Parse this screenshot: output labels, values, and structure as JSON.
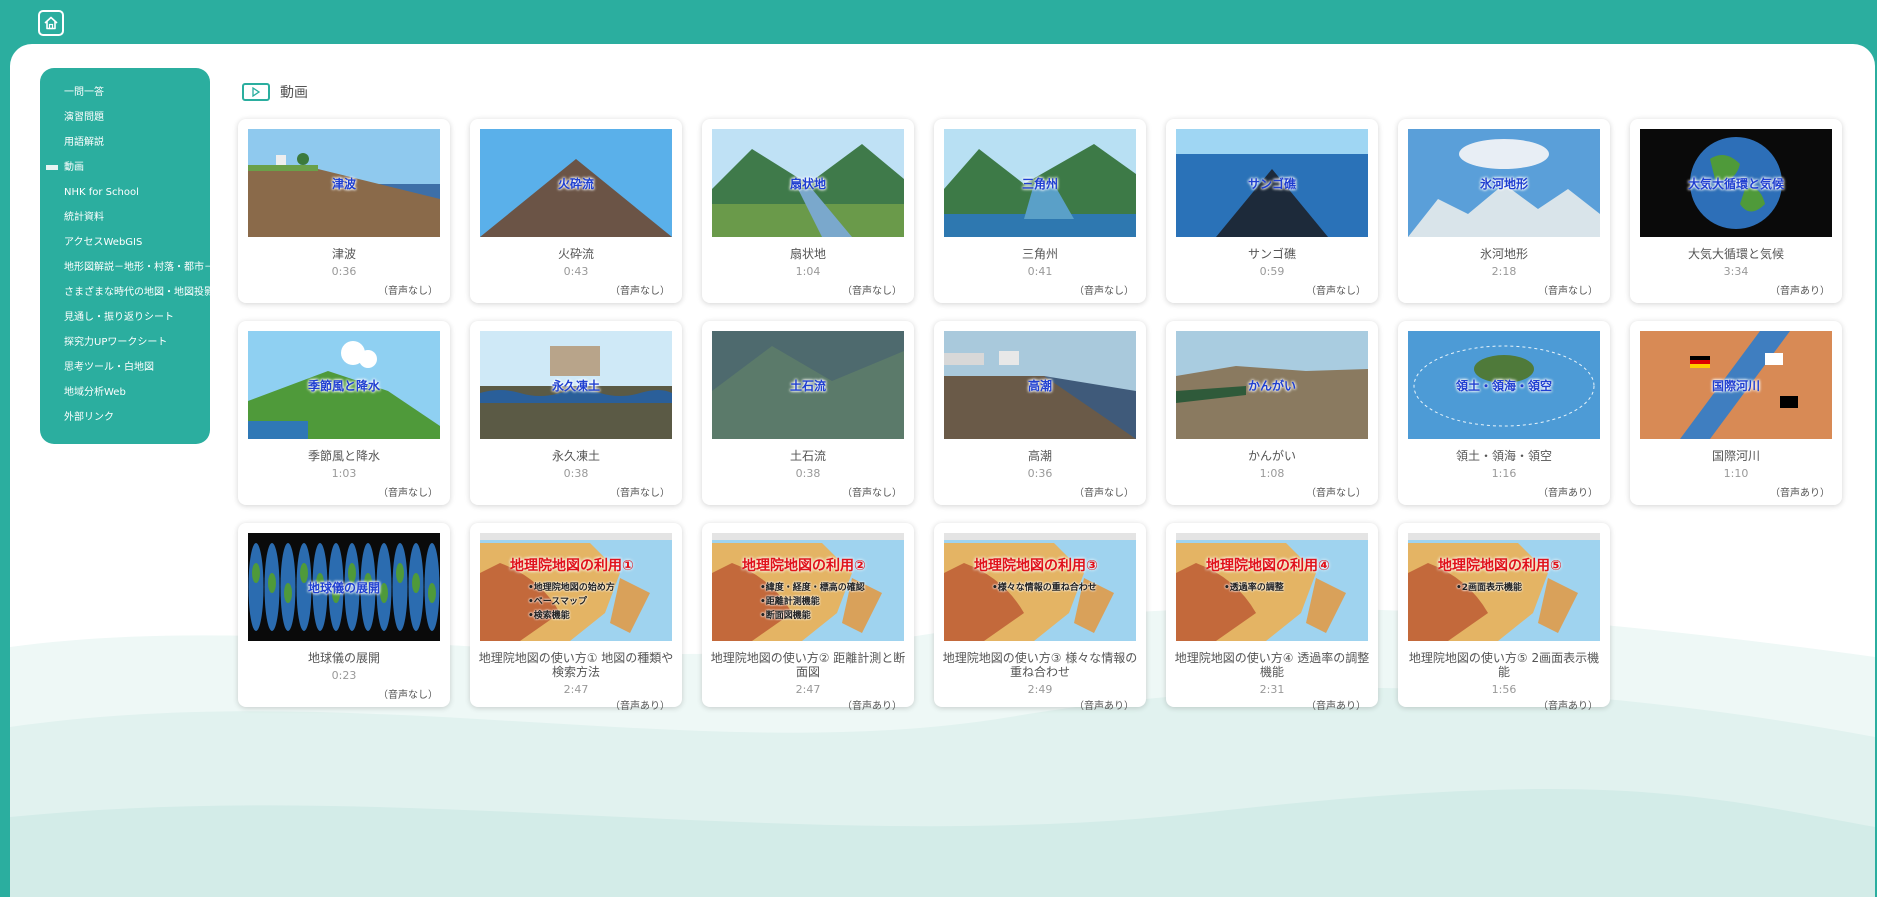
{
  "header": {
    "home_icon": "home-icon"
  },
  "sidebar": {
    "items": [
      {
        "label": "一問一答",
        "active": false
      },
      {
        "label": "演習問題",
        "active": false
      },
      {
        "label": "用語解説",
        "active": false
      },
      {
        "label": "動画",
        "active": true
      },
      {
        "label": "NHK for School",
        "active": false
      },
      {
        "label": "統計資料",
        "active": false
      },
      {
        "label": "アクセスWebGIS",
        "active": false
      },
      {
        "label": "地形図解説－地形・村落・都市－",
        "active": false
      },
      {
        "label": "さまざまな時代の地図・地図投影法",
        "active": false
      },
      {
        "label": "見通し・振り返りシート",
        "active": false
      },
      {
        "label": "探究力UPワークシート",
        "active": false
      },
      {
        "label": "思考ツール・白地図",
        "active": false
      },
      {
        "label": "地域分析Web",
        "active": false
      },
      {
        "label": "外部リンク",
        "active": false
      }
    ]
  },
  "section": {
    "title": "動画",
    "icon": "play-icon"
  },
  "videos": [
    {
      "title": "津波",
      "time": "0:36",
      "audio": "（音声なし）",
      "thumb_text": "津波",
      "scene": "coast"
    },
    {
      "title": "火砕流",
      "time": "0:43",
      "audio": "（音声なし）",
      "thumb_text": "火砕流",
      "scene": "volcano"
    },
    {
      "title": "扇状地",
      "time": "1:04",
      "audio": "（音声なし）",
      "thumb_text": "扇状地",
      "scene": "valley"
    },
    {
      "title": "三角州",
      "time": "0:41",
      "audio": "（音声なし）",
      "thumb_text": "三角州",
      "scene": "delta"
    },
    {
      "title": "サンゴ礁",
      "time": "0:59",
      "audio": "（音声なし）",
      "thumb_text": "サンゴ礁",
      "scene": "sea"
    },
    {
      "title": "氷河地形",
      "time": "2:18",
      "audio": "（音声なし）",
      "thumb_text": "氷河地形",
      "scene": "glacier"
    },
    {
      "title": "大気大循環と気候",
      "time": "3:34",
      "audio": "（音声あり）",
      "thumb_text": "大気大循環と気候",
      "scene": "globe"
    },
    {
      "title": "季節風と降水",
      "time": "1:03",
      "audio": "（音声なし）",
      "thumb_text": "季節風と降水",
      "scene": "monsoon"
    },
    {
      "title": "永久凍土",
      "time": "0:38",
      "audio": "（音声なし）",
      "thumb_text": "永久凍土",
      "scene": "permafrost"
    },
    {
      "title": "土石流",
      "time": "0:38",
      "audio": "（音声なし）",
      "thumb_text": "土石流",
      "scene": "debris"
    },
    {
      "title": "高潮",
      "time": "0:36",
      "audio": "（音声なし）",
      "thumb_text": "高潮",
      "scene": "surge"
    },
    {
      "title": "かんがい",
      "time": "1:08",
      "audio": "（音声なし）",
      "thumb_text": "かんがい",
      "scene": "irrigation"
    },
    {
      "title": "領土・領海・領空",
      "time": "1:16",
      "audio": "（音声あり）",
      "thumb_text": "領土・領海・領空",
      "scene": "island"
    },
    {
      "title": "国際河川",
      "time": "1:10",
      "audio": "（音声あり）",
      "thumb_text": "国際河川",
      "scene": "river"
    },
    {
      "title": "地球儀の展開",
      "time": "0:23",
      "audio": "（音声なし）",
      "thumb_text": "地球儀の展開",
      "scene": "gores"
    },
    {
      "title": "地理院地図の使い方① 地図の種類や検索方法",
      "time": "2:47",
      "audio": "（音声あり）",
      "scene": "map",
      "map_title": "地理院地図の利用①",
      "bullets": [
        "•地理院地図の始め方",
        "•ベースマップ",
        "•検索機能"
      ]
    },
    {
      "title": "地理院地図の使い方② 距離計測と断面図",
      "time": "2:47",
      "audio": "（音声あり）",
      "scene": "map",
      "map_title": "地理院地図の利用②",
      "bullets": [
        "•緯度・経度・標高の確認",
        "•距離計測機能",
        "•断面図機能"
      ]
    },
    {
      "title": "地理院地図の使い方③ 様々な情報の重ね合わせ",
      "time": "2:49",
      "audio": "（音声あり）",
      "scene": "map",
      "map_title": "地理院地図の利用③",
      "bullets": [
        "•様々な情報の重ね合わせ"
      ]
    },
    {
      "title": "地理院地図の使い方④ 透過率の調整機能",
      "time": "2:31",
      "audio": "（音声あり）",
      "scene": "map",
      "map_title": "地理院地図の利用④",
      "bullets": [
        "•透過率の調整"
      ]
    },
    {
      "title": "地理院地図の使い方⑤ 2画面表示機能",
      "time": "1:56",
      "audio": "（音声あり）",
      "scene": "map",
      "map_title": "地理院地図の利用⑤",
      "bullets": [
        "•2画面表示機能"
      ]
    }
  ],
  "colors": {
    "accent": "#2bae9f",
    "panel": "#ffffff",
    "thumb_text": "#1f3fd0",
    "map_title": "#e0121b"
  }
}
